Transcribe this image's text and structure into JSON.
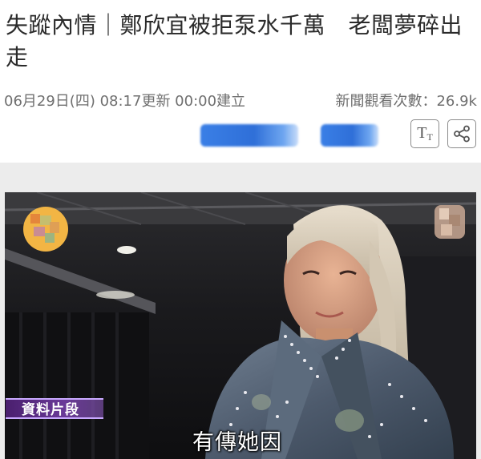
{
  "article": {
    "headline": "失蹤內情｜鄭欣宜被拒泵水千萬　老闆夢碎出走",
    "date_line": "06月29日(四) 08:17更新 00:00建立",
    "views_line": "新聞觀看次數：26.9k"
  },
  "toolbar": {
    "font_size_icon": "text-size-icon",
    "share_icon": "share-icon",
    "font_big": "T",
    "font_small": "T"
  },
  "video": {
    "tag_label": "資料片段",
    "subtitle": "有傳她因"
  },
  "colors": {
    "headline": "#2a2a2a",
    "meta": "#6f6f6f",
    "blurred_button": "#2f6fd8",
    "tag_bg": "#4a1f6e",
    "band": "#ececec"
  }
}
